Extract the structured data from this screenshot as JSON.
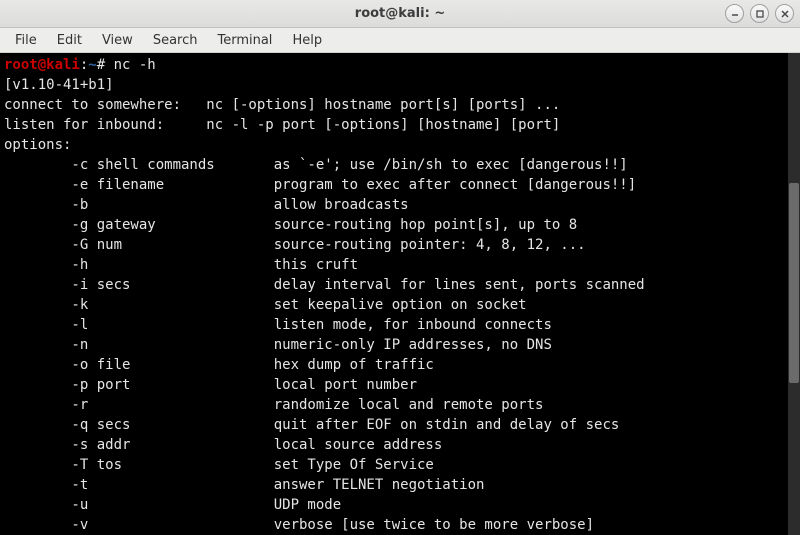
{
  "window": {
    "title": "root@kali: ~"
  },
  "menubar": {
    "file": "File",
    "edit": "Edit",
    "view": "View",
    "search": "Search",
    "terminal": "Terminal",
    "help": "Help"
  },
  "prompt": {
    "userhost": "root@kali",
    "sep": ":",
    "path": "~",
    "hash": "#",
    "command": "nc -h"
  },
  "output": {
    "version": "[v1.10-41+b1]",
    "connect": "connect to somewhere:   nc [-options] hostname port[s] [ports] ...",
    "listen": "listen for inbound:     nc -l -p port [-options] [hostname] [port]",
    "opts_hdr": "options:"
  },
  "options": [
    {
      "flag": "-c shell commands",
      "desc": "as `-e'; use /bin/sh to exec [dangerous!!]"
    },
    {
      "flag": "-e filename",
      "desc": "program to exec after connect [dangerous!!]"
    },
    {
      "flag": "-b",
      "desc": "allow broadcasts"
    },
    {
      "flag": "-g gateway",
      "desc": "source-routing hop point[s], up to 8"
    },
    {
      "flag": "-G num",
      "desc": "source-routing pointer: 4, 8, 12, ..."
    },
    {
      "flag": "-h",
      "desc": "this cruft"
    },
    {
      "flag": "-i secs",
      "desc": "delay interval for lines sent, ports scanned"
    },
    {
      "flag": "-k",
      "desc": "set keepalive option on socket"
    },
    {
      "flag": "-l",
      "desc": "listen mode, for inbound connects"
    },
    {
      "flag": "-n",
      "desc": "numeric-only IP addresses, no DNS"
    },
    {
      "flag": "-o file",
      "desc": "hex dump of traffic"
    },
    {
      "flag": "-p port",
      "desc": "local port number"
    },
    {
      "flag": "-r",
      "desc": "randomize local and remote ports"
    },
    {
      "flag": "-q secs",
      "desc": "quit after EOF on stdin and delay of secs"
    },
    {
      "flag": "-s addr",
      "desc": "local source address"
    },
    {
      "flag": "-T tos",
      "desc": "set Type Of Service"
    },
    {
      "flag": "-t",
      "desc": "answer TELNET negotiation"
    },
    {
      "flag": "-u",
      "desc": "UDP mode"
    },
    {
      "flag": "-v",
      "desc": "verbose [use twice to be more verbose]"
    }
  ],
  "layout": {
    "flag_col_start": 8,
    "desc_col_start": 32
  }
}
